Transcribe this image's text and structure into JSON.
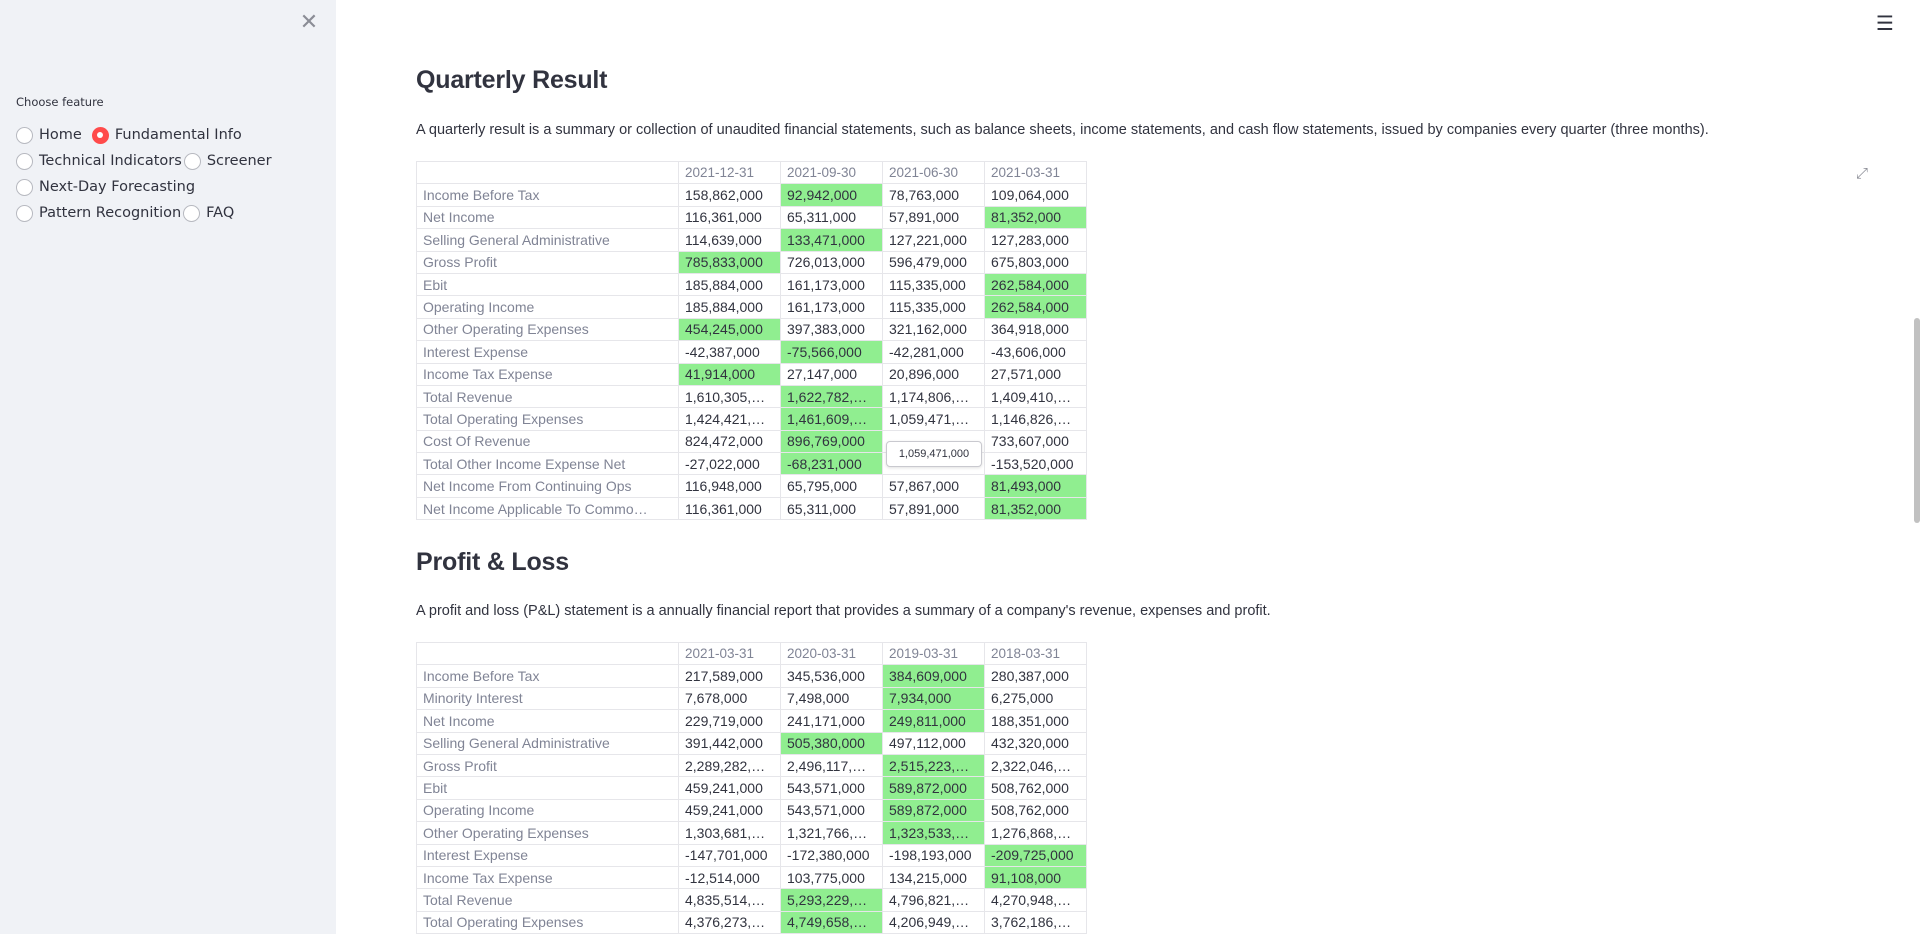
{
  "sidebar": {
    "close_icon": "close-icon",
    "choose_label": "Choose feature",
    "options": [
      {
        "label": "Home",
        "checked": false
      },
      {
        "label": "Fundamental Info",
        "checked": true
      },
      {
        "label": "Technical Indicators",
        "checked": false
      },
      {
        "label": "Screener",
        "checked": false
      },
      {
        "label": "Next-Day Forecasting",
        "checked": false
      },
      {
        "label": "Pattern Recognition",
        "checked": false
      },
      {
        "label": "FAQ",
        "checked": false
      }
    ]
  },
  "header": {
    "menu_icon": "hamburger-menu-icon"
  },
  "quarterly": {
    "title": "Quarterly Result",
    "description": "A quarterly result is a summary or collection of unaudited financial statements, such as balance sheets, income statements, and cash flow statements, issued by companies every quarter (three months).",
    "columns": [
      "2021-12-31",
      "2021-09-30",
      "2021-06-30",
      "2021-03-31"
    ],
    "rows": [
      {
        "label": "Income Before Tax",
        "values": [
          "158,862,000",
          "92,942,000",
          "78,763,000",
          "109,064,000"
        ],
        "highlight": [
          1
        ]
      },
      {
        "label": "Net Income",
        "values": [
          "116,361,000",
          "65,311,000",
          "57,891,000",
          "81,352,000"
        ],
        "highlight": [
          3
        ]
      },
      {
        "label": "Selling General Administrative",
        "values": [
          "114,639,000",
          "133,471,000",
          "127,221,000",
          "127,283,000"
        ],
        "highlight": [
          1
        ]
      },
      {
        "label": "Gross Profit",
        "values": [
          "785,833,000",
          "726,013,000",
          "596,479,000",
          "675,803,000"
        ],
        "highlight": [
          0
        ]
      },
      {
        "label": "Ebit",
        "values": [
          "185,884,000",
          "161,173,000",
          "115,335,000",
          "262,584,000"
        ],
        "highlight": [
          3
        ]
      },
      {
        "label": "Operating Income",
        "values": [
          "185,884,000",
          "161,173,000",
          "115,335,000",
          "262,584,000"
        ],
        "highlight": [
          3
        ]
      },
      {
        "label": "Other Operating Expenses",
        "values": [
          "454,245,000",
          "397,383,000",
          "321,162,000",
          "364,918,000"
        ],
        "highlight": [
          0
        ]
      },
      {
        "label": "Interest Expense",
        "values": [
          "-42,387,000",
          "-75,566,000",
          "-42,281,000",
          "-43,606,000"
        ],
        "highlight": [
          1
        ]
      },
      {
        "label": "Income Tax Expense",
        "values": [
          "41,914,000",
          "27,147,000",
          "20,896,000",
          "27,571,000"
        ],
        "highlight": [
          0
        ]
      },
      {
        "label": "Total Revenue",
        "values": [
          "1,610,305,…",
          "1,622,782,…",
          "1,174,806,…",
          "1,409,410,…"
        ],
        "highlight": [
          1
        ]
      },
      {
        "label": "Total Operating Expenses",
        "values": [
          "1,424,421,…",
          "1,461,609,…",
          "1,059,471,…",
          "1,146,826,…"
        ],
        "highlight": [
          1
        ]
      },
      {
        "label": "Cost Of Revenue",
        "values": [
          "824,472,000",
          "896,769,000",
          "",
          "733,607,000"
        ],
        "highlight": [
          1
        ]
      },
      {
        "label": "Total Other Income Expense Net",
        "values": [
          "-27,022,000",
          "-68,231,000",
          "",
          "-153,520,000"
        ],
        "highlight": [
          1
        ]
      },
      {
        "label": "Net Income From Continuing Ops",
        "values": [
          "116,948,000",
          "65,795,000",
          "57,867,000",
          "81,493,000"
        ],
        "highlight": [
          3
        ]
      },
      {
        "label": "Net Income Applicable To Commo…",
        "values": [
          "116,361,000",
          "65,311,000",
          "57,891,000",
          "81,352,000"
        ],
        "highlight": [
          3
        ]
      }
    ],
    "tooltip": "1,059,471,000"
  },
  "pnl": {
    "title": "Profit & Loss",
    "description": "A profit and loss (P&L) statement is a annually financial report that provides a summary of a company's revenue, expenses and profit.",
    "columns": [
      "2021-03-31",
      "2020-03-31",
      "2019-03-31",
      "2018-03-31"
    ],
    "rows": [
      {
        "label": "Income Before Tax",
        "values": [
          "217,589,000",
          "345,536,000",
          "384,609,000",
          "280,387,000"
        ],
        "highlight": [
          2
        ]
      },
      {
        "label": "Minority Interest",
        "values": [
          "7,678,000",
          "7,498,000",
          "7,934,000",
          "6,275,000"
        ],
        "highlight": [
          2
        ]
      },
      {
        "label": "Net Income",
        "values": [
          "229,719,000",
          "241,171,000",
          "249,811,000",
          "188,351,000"
        ],
        "highlight": [
          2
        ]
      },
      {
        "label": "Selling General Administrative",
        "values": [
          "391,442,000",
          "505,380,000",
          "497,112,000",
          "432,320,000"
        ],
        "highlight": [
          1
        ]
      },
      {
        "label": "Gross Profit",
        "values": [
          "2,289,282,…",
          "2,496,117,…",
          "2,515,223,…",
          "2,322,046,…"
        ],
        "highlight": [
          2
        ]
      },
      {
        "label": "Ebit",
        "values": [
          "459,241,000",
          "543,571,000",
          "589,872,000",
          "508,762,000"
        ],
        "highlight": [
          2
        ]
      },
      {
        "label": "Operating Income",
        "values": [
          "459,241,000",
          "543,571,000",
          "589,872,000",
          "508,762,000"
        ],
        "highlight": [
          2
        ]
      },
      {
        "label": "Other Operating Expenses",
        "values": [
          "1,303,681,…",
          "1,321,766,…",
          "1,323,533,…",
          "1,276,868,…"
        ],
        "highlight": [
          2
        ]
      },
      {
        "label": "Interest Expense",
        "values": [
          "-147,701,000",
          "-172,380,000",
          "-198,193,000",
          "-209,725,000"
        ],
        "highlight": [
          3
        ]
      },
      {
        "label": "Income Tax Expense",
        "values": [
          "-12,514,000",
          "103,775,000",
          "134,215,000",
          "91,108,000"
        ],
        "highlight": [
          3
        ]
      },
      {
        "label": "Total Revenue",
        "values": [
          "4,835,514,…",
          "5,293,229,…",
          "4,796,821,…",
          "4,270,948,…"
        ],
        "highlight": [
          1
        ]
      },
      {
        "label": "Total Operating Expenses",
        "values": [
          "4,376,273,…",
          "4,749,658,…",
          "4,206,949,…",
          "3,762,186,…"
        ],
        "highlight": [
          1
        ]
      }
    ]
  },
  "colors": {
    "highlight": "#90ee90",
    "accent": "#ff4b4b",
    "sidebar_bg": "#f0f2f6"
  },
  "expand_icon": "fullscreen-expand-icon"
}
